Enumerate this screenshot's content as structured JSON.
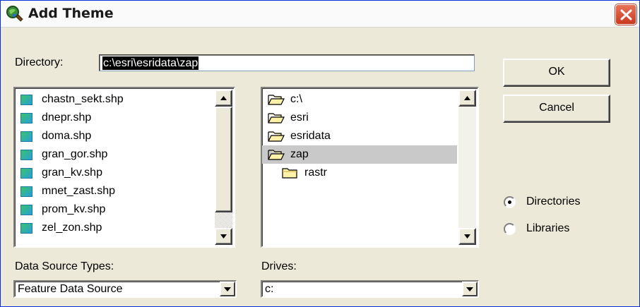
{
  "window": {
    "title": "Add Theme",
    "title_icon": "magnifier-globe-icon",
    "close_icon": "close-icon",
    "close_color": "#d9532f"
  },
  "directory": {
    "label": "Directory:",
    "value": "c:\\esri\\esridata\\zap"
  },
  "files": {
    "icon": "shapefile-icon",
    "items": [
      "chastn_sekt.shp",
      "dnepr.shp",
      "doma.shp",
      "gran_gor.shp",
      "gran_kv.shp",
      "mnet_zast.shp",
      "prom_kv.shp",
      "zel_zon.shp"
    ]
  },
  "folders": {
    "items": [
      {
        "label": "c:\\",
        "icon": "open-folder-icon",
        "selected": false
      },
      {
        "label": "esri",
        "icon": "open-folder-icon",
        "selected": false
      },
      {
        "label": "esridata",
        "icon": "open-folder-icon",
        "selected": false
      },
      {
        "label": "zap",
        "icon": "open-folder-icon",
        "selected": true
      },
      {
        "label": "rastr",
        "icon": "closed-folder-icon",
        "selected": false
      }
    ]
  },
  "buttons": {
    "ok": "OK",
    "cancel": "Cancel"
  },
  "view_mode": {
    "directories": "Directories",
    "libraries": "Libraries",
    "selected": "Directories"
  },
  "data_source": {
    "label": "Data Source Types:",
    "value": "Feature Data Source"
  },
  "drives": {
    "label": "Drives:",
    "value": "c:"
  }
}
